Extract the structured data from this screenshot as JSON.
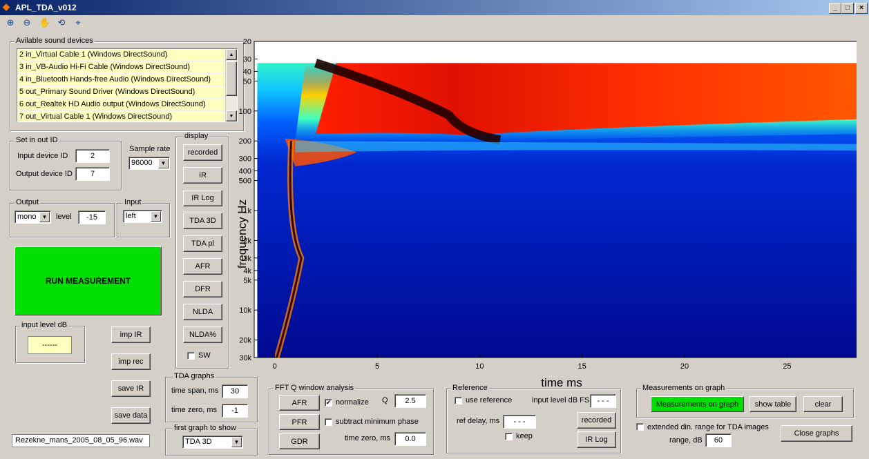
{
  "window": {
    "title": "APL_TDA_v012",
    "min": "_",
    "max": "□",
    "close": "×"
  },
  "toolbar": [
    "zoom-in-icon",
    "zoom-out-icon",
    "pan-icon",
    "rotate-icon",
    "datacursor-icon"
  ],
  "devices": {
    "title": "Avilable sound devices",
    "items": [
      "2 in_Virtual Cable 1 (Windows DirectSound)",
      "3 in_VB-Audio Hi-Fi Cable (Windows DirectSound)",
      "4 in_Bluetooth Hands-free Audio (Windows DirectSound)",
      "5 out_Primary Sound Driver (Windows DirectSound)",
      "6 out_Realtek HD Audio output (Windows DirectSound)",
      "7 out_Virtual Cable 1 (Windows DirectSound)"
    ]
  },
  "setid": {
    "title": "Set in out ID",
    "input_label": "Input device ID",
    "input_value": "2",
    "output_label": "Output device ID",
    "output_value": "7"
  },
  "samplerate": {
    "label": "Sample rate",
    "value": "96000"
  },
  "output": {
    "title": "Output",
    "mode": "mono",
    "level_label": "level",
    "level_value": "-15"
  },
  "input": {
    "title": "Input",
    "channel": "left"
  },
  "run_button": "RUN MEASUREMENT",
  "inlevel": {
    "title": "input level dB",
    "value": "------"
  },
  "buttons": {
    "imp_ir": "imp IR",
    "imp_rec": "imp rec",
    "save_ir": "save IR",
    "save_data": "save data"
  },
  "filename": "Rezekne_mans_2005_08_05_96.wav",
  "display": {
    "title": "display",
    "buttons": [
      "recorded",
      "IR",
      "IR Log",
      "TDA 3D",
      "TDA pl",
      "AFR",
      "DFR",
      "NLDA",
      "NLDA%"
    ],
    "sw_label": "SW"
  },
  "tda_graphs": {
    "title": "TDA graphs",
    "span_label": "time span, ms",
    "span_value": "30",
    "zero_label": "time zero, ms",
    "zero_value": "-1"
  },
  "first_graph": {
    "title": "first graph to show",
    "value": "TDA 3D"
  },
  "fftq": {
    "title": "FFT Q window analysis",
    "afr": "AFR",
    "pfr": "PFR",
    "gdr": "GDR",
    "normalize_label": "normalize",
    "normalize_checked": true,
    "subtract_label": "subtract minimum phase",
    "q_label": "Q",
    "q_value": "2.5",
    "tz_label": "time zero, ms",
    "tz_value": "0.0"
  },
  "reference": {
    "title": "Reference",
    "use_label": "use reference",
    "inlevel_label": "input level dB FS",
    "inlevel_value": "- - -",
    "delay_label": "ref delay, ms",
    "delay_value": "- - -",
    "keep_label": "keep",
    "recorded": "recorded",
    "irlog": "IR Log"
  },
  "meas_graph": {
    "title": "Measurements on graph",
    "meas_btn": "Measurements on graph",
    "show_table": "show table",
    "clear": "clear"
  },
  "extended": {
    "label": "extended din. range for TDA images",
    "range_label": "range, dB",
    "range_value": "60"
  },
  "close_graphs": "Close graphs",
  "chart_data": {
    "type": "heatmap",
    "xlabel": "time   ms",
    "ylabel": "frequency   Hz",
    "x_ticks": [
      "0",
      "5",
      "10",
      "15",
      "20",
      "25"
    ],
    "x_range": [
      -1,
      29
    ],
    "y_scale": "log",
    "y_ticks": [
      "20",
      "30",
      "40",
      "50",
      "100",
      "200",
      "300",
      "400",
      "500",
      "1k",
      "2k",
      "3k",
      "4k",
      "5k",
      "10k",
      "20k",
      "30k"
    ],
    "y_range": [
      20,
      30000
    ],
    "colormap": "jet"
  }
}
